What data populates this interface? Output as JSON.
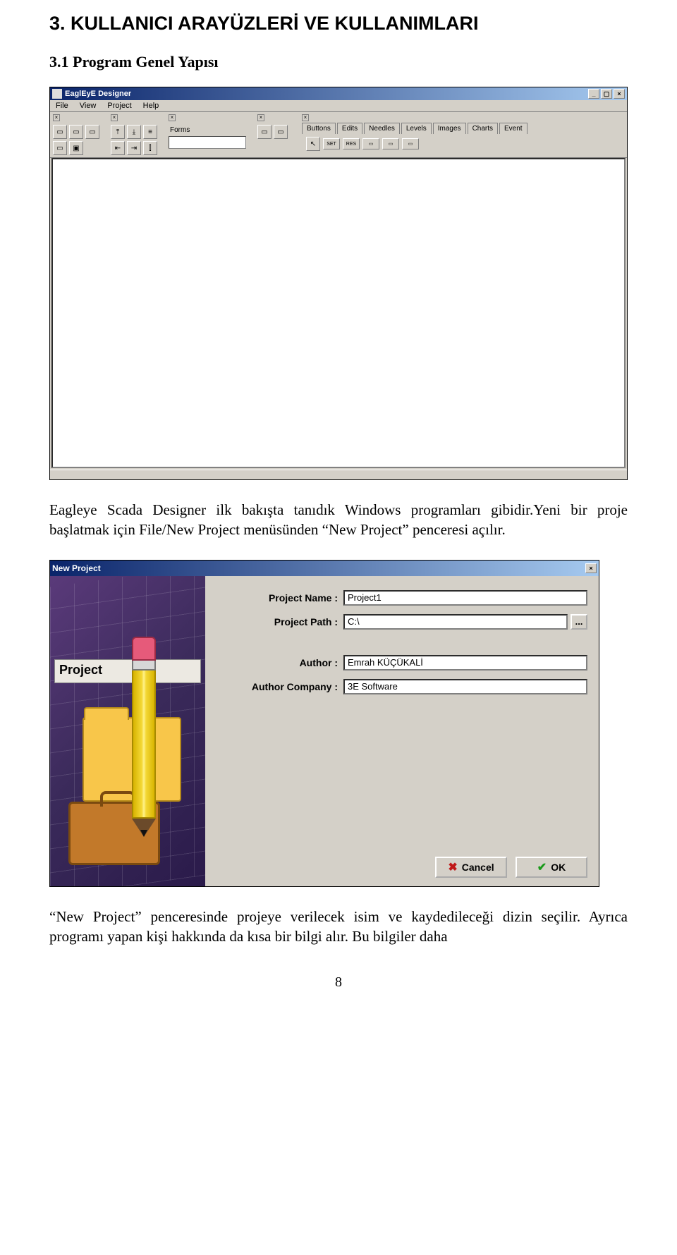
{
  "heading": "3. KULLANICI ARAYÜZLERİ VE KULLANIMLARI",
  "subheading": "3.1 Program Genel Yapısı",
  "para1": "Eagleye Scada Designer ilk bakışta tanıdık Windows programları gibidir.Yeni bir proje başlatmak için File/New Project menüsünden “New Project” penceresi açılır.",
  "para2": "“New Project” penceresinde projeye verilecek isim ve kaydedileceği dizin seçilir. Ayrıca programı yapan kişi hakkında da kısa bir bilgi alır. Bu bilgiler daha",
  "page_number": "8",
  "designer": {
    "title": "EaglEyE Designer",
    "menu": [
      "File",
      "View",
      "Project",
      "Help"
    ],
    "forms_label": "Forms",
    "tabs": [
      "Buttons",
      "Edits",
      "Needles",
      "Levels",
      "Images",
      "Charts",
      "Event"
    ],
    "winbtns": {
      "min": "_",
      "max": "▢",
      "close": "×"
    }
  },
  "dialog": {
    "title": "New Project",
    "side_label": "Project",
    "fields": {
      "name_label": "Project Name :",
      "name_value": "Project1",
      "path_label": "Project Path :",
      "path_value": "C:\\",
      "browse": "...",
      "author_label": "Author :",
      "author_value": "Emrah KÜÇÜKALİ",
      "company_label": "Author Company :",
      "company_value": "3E Software"
    },
    "buttons": {
      "cancel": "Cancel",
      "ok": "OK"
    },
    "close": "×"
  }
}
